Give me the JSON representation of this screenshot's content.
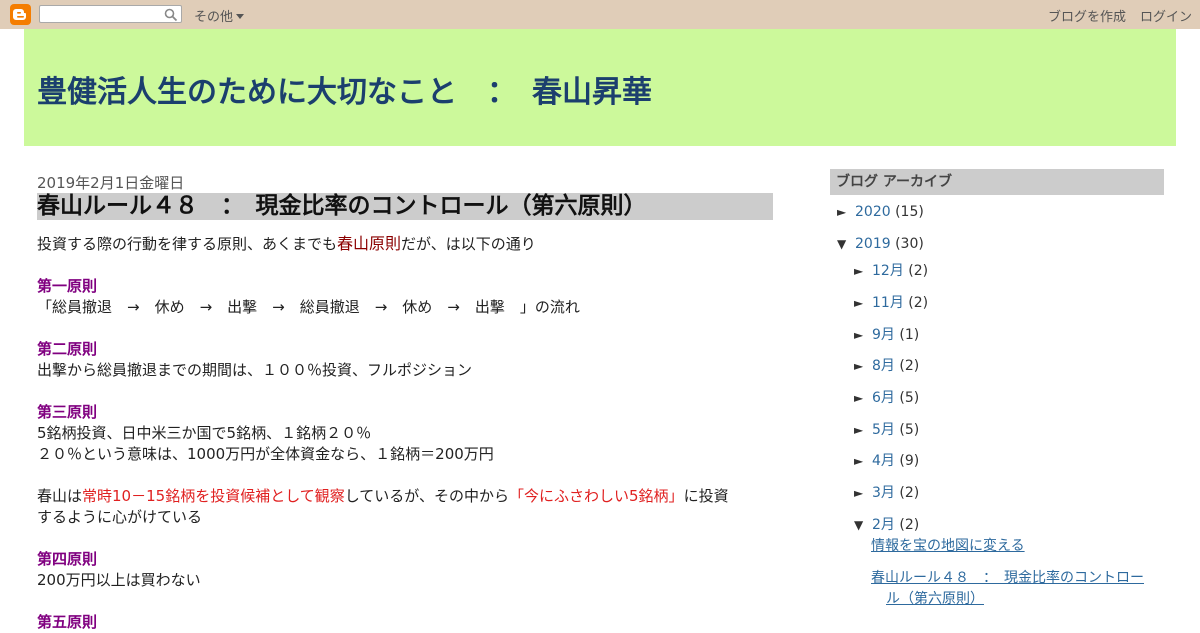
{
  "navbar": {
    "search_placeholder": "",
    "more_label": "その他",
    "create_blog_label": "ブログを作成",
    "login_label": "ログイン"
  },
  "header": {
    "title": "豊健活人生のために大切なこと　：　春山昇華"
  },
  "post": {
    "date": "2019年2月1日金曜日",
    "title": "春山ルール４８　：　現金比率のコントロール（第六原則）",
    "intro_before": "投資する際の行動を律する原則、あくまでも",
    "intro_link": "春山原則",
    "intro_after": "だが、は以下の通り",
    "p1_heading": "第一原則",
    "p1_text": "「総員撤退　→　休め　→　出撃　→　総員撤退　→　休め　→　出撃　」の流れ",
    "p2_heading": "第二原則",
    "p2_text": "出撃から総員撤退までの期間は、１００％投資、フルポジション",
    "p3_heading": "第三原則",
    "p3_line1": "5銘柄投資、日中米三か国で5銘柄、１銘柄２０％",
    "p3_line2": "２０％という意味は、1000万円が全体資金なら、１銘柄＝200万円",
    "p3b_before": "春山は",
    "p3b_red1": "常時10－15銘柄を投資候補として観察",
    "p3b_mid": "しているが、その中から",
    "p3b_red2": "「今にふさわしい5銘柄」",
    "p3b_after": "に投資",
    "p3b_line2": "するように心がけている",
    "p4_heading": "第四原則",
    "p4_text": "200万円以上は買わない",
    "p5_heading": "第五原則"
  },
  "sidebar": {
    "title": "ブログ アーカイブ",
    "years": [
      {
        "toggle": "►",
        "label": "2020",
        "count": "(15)"
      },
      {
        "toggle": "▼",
        "label": "2019",
        "count": "(30)"
      }
    ],
    "months": [
      {
        "toggle": "►",
        "label": "12月",
        "count": "(2)"
      },
      {
        "toggle": "►",
        "label": "11月",
        "count": "(2)"
      },
      {
        "toggle": "►",
        "label": "9月",
        "count": "(1)"
      },
      {
        "toggle": "►",
        "label": "8月",
        "count": "(2)"
      },
      {
        "toggle": "►",
        "label": "6月",
        "count": "(5)"
      },
      {
        "toggle": "►",
        "label": "5月",
        "count": "(5)"
      },
      {
        "toggle": "►",
        "label": "4月",
        "count": "(9)"
      },
      {
        "toggle": "►",
        "label": "3月",
        "count": "(2)"
      },
      {
        "toggle": "▼",
        "label": "2月",
        "count": "(2)"
      }
    ],
    "posts": [
      {
        "line1": "情報を宝の地図に変える",
        "line2": ""
      },
      {
        "line1": "春山ルール４８　：　現金比率のコントロー",
        "line2": "ル（第六原則）"
      }
    ]
  }
}
